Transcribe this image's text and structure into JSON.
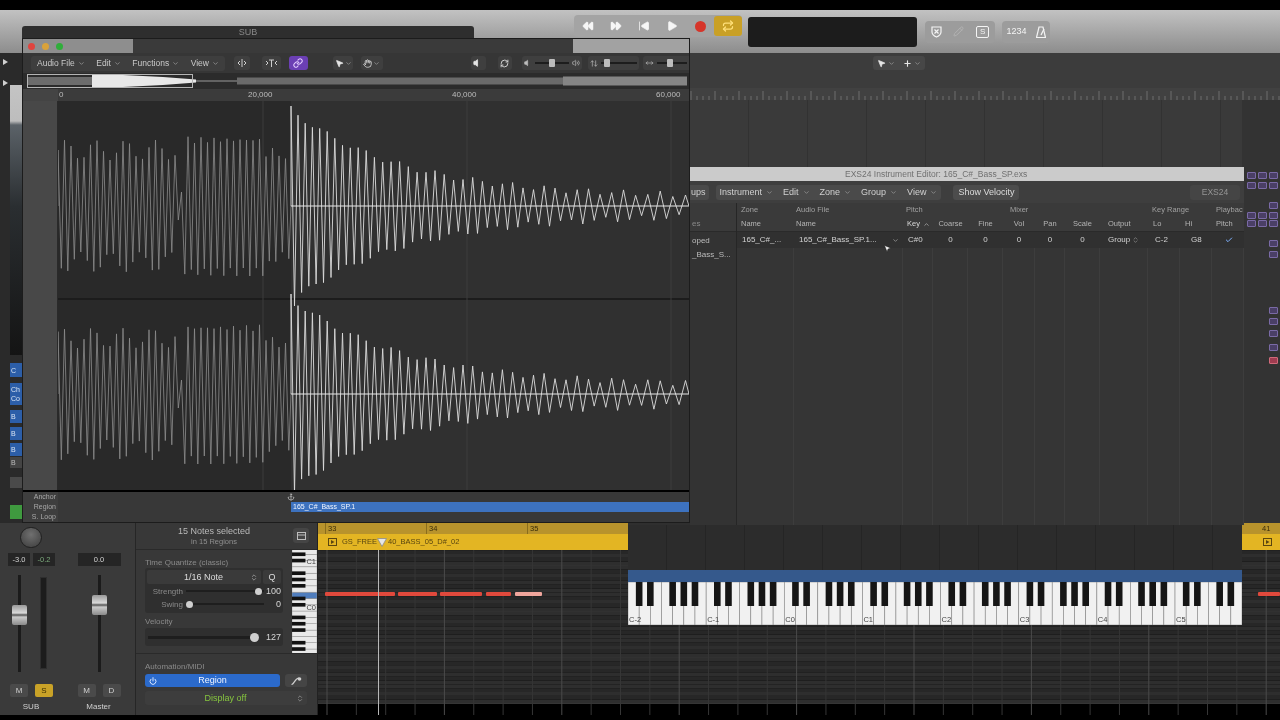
{
  "control_bar": {
    "cycle_on": true,
    "mode_button": "S",
    "count_in": "1234"
  },
  "background_window": {
    "title": "SUB"
  },
  "track_list": {
    "inspector_buttons": [
      {
        "lines": [
          "C"
        ],
        "active": true
      },
      {
        "lines": [
          "Ch",
          "Co"
        ],
        "active": true
      },
      {
        "lines": [
          "B"
        ],
        "active": true
      },
      {
        "lines": [
          "B"
        ],
        "active": true
      },
      {
        "lines": [
          "B"
        ],
        "active": true
      },
      {
        "lines": [
          "B"
        ],
        "active": false
      }
    ]
  },
  "audio_editor": {
    "menus": [
      {
        "label": "Audio File"
      },
      {
        "label": "Edit"
      },
      {
        "label": "Functions"
      },
      {
        "label": "View"
      }
    ],
    "link_on": true,
    "volume": {
      "level": 0.5
    },
    "vertical_zoom": {
      "level": 0.1
    },
    "horizontal_zoom": {
      "level": 0.4
    },
    "ruler": [
      "0",
      "20,000",
      "40,000",
      "60,000"
    ],
    "lanes": [
      "Anchor",
      "Region",
      "S. Loop"
    ],
    "region_name": "165_C#_Bass_SP.1"
  },
  "exs24": {
    "title": "EXS24 Instrument Editor: 165_C#_Bass_SP.exs",
    "groups_button": "ups",
    "menus": [
      {
        "label": "Instrument"
      },
      {
        "label": "Edit"
      },
      {
        "label": "Zone"
      },
      {
        "label": "Group"
      },
      {
        "label": "View"
      }
    ],
    "show_velocity": "Show Velocity",
    "badge": "EXS24",
    "sidebar": {
      "header": "es",
      "items": [
        "oped",
        "_Bass_S..."
      ]
    },
    "column_groups": [
      {
        "label": "Zone"
      },
      {
        "label": "Audio File"
      },
      {
        "label": "Pitch"
      },
      {
        "label": "Mixer"
      },
      {
        "label": "Key Range"
      },
      {
        "label": "Playbac"
      }
    ],
    "columns": [
      {
        "label": "Name",
        "sorted": false
      },
      {
        "label": "Name",
        "sorted": false
      },
      {
        "label": "Key",
        "sorted": true
      },
      {
        "label": "Coarse",
        "sorted": false
      },
      {
        "label": "Fine",
        "sorted": false
      },
      {
        "label": "Vol",
        "sorted": false
      },
      {
        "label": "Pan",
        "sorted": false
      },
      {
        "label": "Scale",
        "sorted": false
      },
      {
        "label": "Output",
        "sorted": false
      },
      {
        "label": "Lo",
        "sorted": false
      },
      {
        "label": "Hi",
        "sorted": false
      },
      {
        "label": "Pitch",
        "sorted": false
      }
    ],
    "rows": [
      {
        "cells": [
          {
            "kind": "text",
            "value": "165_C#_..."
          },
          {
            "kind": "popup",
            "value": "165_C#_Bass_SP.1..."
          },
          {
            "kind": "text",
            "value": "C#0"
          },
          {
            "kind": "number",
            "value": "0"
          },
          {
            "kind": "number",
            "value": "0"
          },
          {
            "kind": "number",
            "value": "0"
          },
          {
            "kind": "number",
            "value": "0"
          },
          {
            "kind": "number",
            "value": "0"
          },
          {
            "kind": "stepper",
            "value": "Group"
          },
          {
            "kind": "text",
            "value": "C-2"
          },
          {
            "kind": "text",
            "value": "G8"
          },
          {
            "kind": "check",
            "checked": true
          }
        ]
      }
    ]
  },
  "keyboard_window": {
    "octave_labels": [
      "C-2",
      "C-1",
      "C0",
      "C1",
      "C2",
      "C3",
      "C4",
      "C5"
    ]
  },
  "mixer": {
    "strips": [
      {
        "kind": "channel",
        "name": "SUB",
        "readouts": [
          {
            "kind": "volume",
            "value": "-3.0"
          },
          {
            "kind": "peak",
            "value": "-0.2"
          }
        ],
        "level": 0.61,
        "buttons": [
          {
            "label": "M",
            "on": false
          },
          {
            "label": "S",
            "on": true
          }
        ]
      },
      {
        "kind": "master",
        "name": "Master",
        "readouts": [
          {
            "kind": "volume",
            "value": "0.0"
          }
        ],
        "level": 0.74,
        "buttons": [
          {
            "label": "M",
            "on": false
          },
          {
            "label": "D",
            "on": false
          }
        ]
      }
    ]
  },
  "piano_roll_inspector": {
    "selection": "15 Notes selected",
    "selection_detail": "in 15 Regions",
    "quantize": {
      "title": "Time Quantize (classic)",
      "value": "1/16 Note",
      "q_label": "Q",
      "sliders": [
        {
          "label": "Strength",
          "level": 0.97,
          "reading": "100"
        },
        {
          "label": "Swing",
          "level": 0.0,
          "reading": "0"
        }
      ]
    },
    "velocity": {
      "label": "Velocity",
      "level": 1.0,
      "reading": "127"
    },
    "automation": {
      "title": "Automation/MIDI",
      "mode": "Region",
      "on": true,
      "display": "Display off"
    }
  },
  "piano_roll": {
    "bars": [
      "33",
      "34",
      "35"
    ],
    "region_name_start": "GS_FREE",
    "region_name_end": "40_BASS_05_D#_02",
    "next_bar": "41",
    "key_labels": [
      "C1",
      "C0"
    ]
  }
}
